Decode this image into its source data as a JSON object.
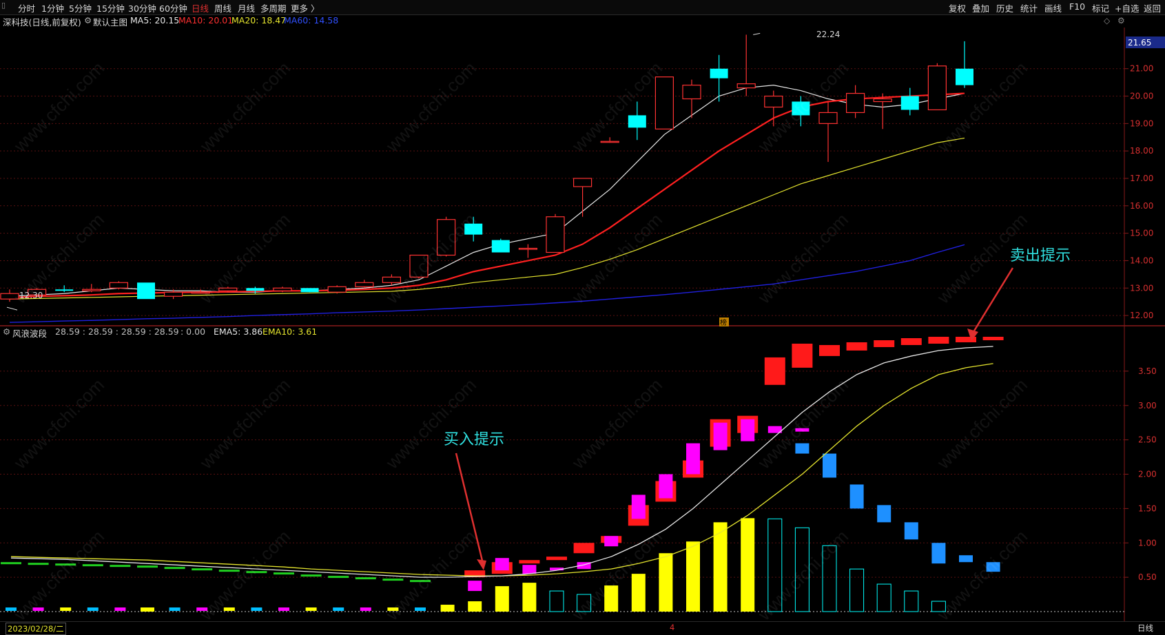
{
  "toolbar": {
    "menu_icon": "menu-icon",
    "periods": [
      "分时",
      "1分钟",
      "5分钟",
      "15分钟",
      "30分钟",
      "60分钟",
      "日线",
      "周线",
      "月线",
      "多周期",
      "更多 〉"
    ],
    "active_period": "日线",
    "right_items": [
      "复权",
      "叠加",
      "历史",
      "统计",
      "画线",
      "F10",
      "标记",
      "+自选",
      "返回"
    ]
  },
  "main_chart": {
    "stock_label": "深科技(日线,前复权)",
    "indicator_name": "默认主图",
    "ma5": "MA5: 20.15",
    "ma10": "MA10: 20.01",
    "ma20": "MA20: 18.47",
    "ma60": "MA60: 14.58",
    "high_label": "22.24",
    "low_label": "12.30",
    "current_price": "21.65",
    "axis_labels": [
      "21.00",
      "20.00",
      "19.00",
      "18.00",
      "17.00",
      "16.00",
      "15.00",
      "14.00",
      "13.00",
      "12.00"
    ],
    "marker_label": "榜"
  },
  "sub_chart": {
    "indicator_name": "风浪波段",
    "values_prefix": "28.59 : 28.59 : 28.59 : 28.59",
    "values_zero": ": 0.00",
    "ema5": "EMA5: 3.86",
    "ema10": "EMA10: 3.61",
    "axis_labels": [
      "3.50",
      "3.00",
      "2.50",
      "2.00",
      "1.50",
      "1.00",
      "0.50"
    ],
    "buy_hint": "买入提示",
    "sell_hint": "卖出提示"
  },
  "status": {
    "date": "2023/02/28/二",
    "month_marker": "4",
    "period": "日线"
  },
  "watermark": "www.cfchi.com",
  "colors": {
    "up": "#ff3232",
    "down": "#00ffff",
    "ma5": "#e8e8e8",
    "ma10": "#ff2020",
    "ma20": "#e6e62e",
    "ma60": "#2020e0",
    "yellow_bar": "#ffff00",
    "magenta": "#ff00ff",
    "blue_block": "#1e90ff",
    "annotation": "#30e0e0"
  },
  "chart_data": [
    {
      "type": "candlestick",
      "title": "深科技(日线,前复权)",
      "x": [
        1,
        2,
        3,
        4,
        5,
        6,
        7,
        8,
        9,
        10,
        11,
        12,
        13,
        14,
        15,
        16,
        17,
        18,
        19,
        20,
        21,
        22,
        23,
        24,
        25,
        26,
        27,
        28,
        29,
        30,
        31,
        32,
        33,
        34,
        35,
        36,
        37
      ],
      "ohlc": [
        [
          12.6,
          12.95,
          12.5,
          12.8
        ],
        [
          12.75,
          13.0,
          12.7,
          12.95
        ],
        [
          12.95,
          13.1,
          12.85,
          12.9
        ],
        [
          12.9,
          13.15,
          12.85,
          12.95
        ],
        [
          13.0,
          13.25,
          12.95,
          13.2
        ],
        [
          13.2,
          13.0,
          12.9,
          12.6
        ],
        [
          12.7,
          12.95,
          12.6,
          12.85
        ],
        [
          12.85,
          12.95,
          12.8,
          12.85
        ],
        [
          12.9,
          13.05,
          12.85,
          13.0
        ],
        [
          13.0,
          13.05,
          12.8,
          12.9
        ],
        [
          12.9,
          13.05,
          12.85,
          13.0
        ],
        [
          13.0,
          12.95,
          12.85,
          12.85
        ],
        [
          12.85,
          13.1,
          12.8,
          13.05
        ],
        [
          13.05,
          13.3,
          13.0,
          13.2
        ],
        [
          13.2,
          13.5,
          13.1,
          13.4
        ],
        [
          13.4,
          14.2,
          13.35,
          14.2
        ],
        [
          14.2,
          15.6,
          14.15,
          15.5
        ],
        [
          15.35,
          15.6,
          14.7,
          14.95
        ],
        [
          14.75,
          14.8,
          14.3,
          14.3
        ],
        [
          14.45,
          14.6,
          14.1,
          14.45
        ],
        [
          14.3,
          15.7,
          14.3,
          15.6
        ],
        [
          16.7,
          17.0,
          15.6,
          17.0
        ],
        [
          18.35,
          18.5,
          18.3,
          18.35
        ],
        [
          19.3,
          19.8,
          18.4,
          18.85
        ],
        [
          18.8,
          20.7,
          18.8,
          20.7
        ],
        [
          19.9,
          20.6,
          19.2,
          20.4
        ],
        [
          21.0,
          21.5,
          19.8,
          20.65
        ],
        [
          20.3,
          22.24,
          20.0,
          20.45
        ],
        [
          19.6,
          20.2,
          18.9,
          20.0
        ],
        [
          19.8,
          20.0,
          18.9,
          19.3
        ],
        [
          19.0,
          19.8,
          17.6,
          19.4
        ],
        [
          19.4,
          20.4,
          19.2,
          20.1
        ],
        [
          19.8,
          20.1,
          18.8,
          19.9
        ],
        [
          20.0,
          20.3,
          19.3,
          19.5
        ],
        [
          19.5,
          21.2,
          19.5,
          21.1
        ],
        [
          21.0,
          22.0,
          20.3,
          20.4
        ]
      ],
      "ylim": [
        11.6,
        22.5
      ],
      "series": [
        {
          "name": "MA5",
          "values": [
            12.7,
            12.75,
            12.8,
            12.9,
            13.0,
            12.95,
            12.9,
            12.9,
            12.85,
            12.85,
            12.9,
            12.9,
            12.95,
            13.0,
            13.1,
            13.3,
            13.8,
            14.3,
            14.6,
            14.8,
            15.0,
            15.8,
            16.6,
            17.6,
            18.6,
            19.3,
            20.0,
            20.3,
            20.4,
            20.2,
            19.9,
            19.7,
            19.6,
            19.7,
            19.9,
            20.1
          ]
        },
        {
          "name": "MA10",
          "values": [
            12.65,
            12.7,
            12.72,
            12.75,
            12.8,
            12.82,
            12.84,
            12.85,
            12.86,
            12.88,
            12.9,
            12.9,
            12.92,
            12.95,
            13.0,
            13.1,
            13.3,
            13.6,
            13.8,
            14.0,
            14.2,
            14.6,
            15.2,
            15.9,
            16.6,
            17.3,
            18.0,
            18.6,
            19.2,
            19.6,
            19.8,
            19.9,
            19.95,
            20.0,
            20.05,
            20.1
          ]
        },
        {
          "name": "MA20",
          "values": [
            12.6,
            12.62,
            12.64,
            12.66,
            12.68,
            12.7,
            12.72,
            12.74,
            12.76,
            12.78,
            12.8,
            12.82,
            12.84,
            12.86,
            12.88,
            12.95,
            13.05,
            13.2,
            13.3,
            13.4,
            13.5,
            13.75,
            14.05,
            14.4,
            14.8,
            15.2,
            15.6,
            16.0,
            16.4,
            16.8,
            17.1,
            17.4,
            17.7,
            18.0,
            18.3,
            18.47
          ]
        },
        {
          "name": "MA60",
          "values": [
            11.75,
            11.77,
            11.8,
            11.82,
            11.85,
            11.88,
            11.9,
            11.93,
            11.96,
            12.0,
            12.03,
            12.06,
            12.1,
            12.13,
            12.16,
            12.2,
            12.25,
            12.3,
            12.35,
            12.4,
            12.46,
            12.52,
            12.6,
            12.68,
            12.76,
            12.85,
            12.95,
            13.05,
            13.15,
            13.3,
            13.45,
            13.6,
            13.8,
            14.0,
            14.3,
            14.58
          ]
        }
      ]
    },
    {
      "type": "bar",
      "title": "风浪波段",
      "ylim": [
        0,
        3.95
      ],
      "yellow_values": [
        0.02,
        0.01,
        0.02,
        0.02,
        0.03,
        0.06,
        0.01,
        0.01,
        0.0,
        0.0,
        0.0,
        0.0,
        0.0,
        0.0,
        0.0,
        0.0,
        0.1,
        0.15,
        0.37,
        0.42,
        0.31,
        0.25,
        0.38,
        0.55,
        0.85,
        1.02,
        1.3,
        1.36,
        1.35,
        1.22,
        0.96,
        0.62,
        0.4,
        0.3,
        0.15,
        0.0,
        0.02,
        0.0
      ],
      "cyan_outline_values": [
        0,
        0,
        0,
        0,
        0,
        0,
        0,
        0,
        0,
        0,
        0,
        0,
        0,
        0,
        0,
        0,
        0,
        0,
        0,
        0,
        0.3,
        0.25,
        0,
        0,
        0,
        0,
        0,
        0,
        1.35,
        1.22,
        0.96,
        0.62,
        0.4,
        0.3,
        0.15,
        0,
        0,
        0
      ],
      "red_blocks": [
        [
          0,
          0,
          0
        ],
        [
          0,
          0,
          0
        ],
        [
          0,
          0,
          0
        ],
        [
          0,
          0,
          0
        ],
        [
          0,
          0,
          0
        ],
        [
          0,
          0,
          0
        ],
        [
          0,
          0,
          0
        ],
        [
          0,
          0,
          0
        ],
        [
          0,
          0,
          0
        ],
        [
          0,
          0,
          0
        ],
        [
          0,
          0,
          0
        ],
        [
          0,
          0,
          0
        ],
        [
          0,
          0,
          0
        ],
        [
          0,
          0,
          0
        ],
        [
          0,
          0,
          0
        ],
        [
          0,
          0,
          0
        ],
        [
          0,
          0,
          0
        ],
        [
          0.5,
          0.6,
          1
        ],
        [
          0.55,
          0.72,
          1
        ],
        [
          0.7,
          0.75,
          1
        ],
        [
          0.75,
          0.8,
          1
        ],
        [
          0.85,
          1.0,
          1
        ],
        [
          1.0,
          1.1,
          1
        ],
        [
          1.25,
          1.55,
          1
        ],
        [
          1.6,
          1.9,
          1
        ],
        [
          1.95,
          2.2,
          1
        ],
        [
          2.4,
          2.8,
          1
        ],
        [
          2.6,
          2.85,
          1
        ],
        [
          3.3,
          3.7,
          1
        ],
        [
          3.55,
          3.9,
          1
        ],
        [
          3.72,
          3.88,
          1
        ],
        [
          3.8,
          3.92,
          1
        ],
        [
          3.85,
          3.95,
          1
        ],
        [
          3.88,
          3.98,
          1
        ],
        [
          3.9,
          4.0,
          1
        ],
        [
          3.92,
          4.0,
          1
        ],
        [
          3.95,
          4.0,
          1
        ]
      ],
      "ema5_values": [
        0.78,
        0.77,
        0.76,
        0.74,
        0.72,
        0.7,
        0.68,
        0.66,
        0.64,
        0.62,
        0.6,
        0.58,
        0.56,
        0.54,
        0.52,
        0.5,
        0.5,
        0.51,
        0.52,
        0.55,
        0.6,
        0.68,
        0.8,
        0.98,
        1.2,
        1.5,
        1.85,
        2.2,
        2.55,
        2.9,
        3.2,
        3.45,
        3.62,
        3.72,
        3.8,
        3.84,
        3.86
      ],
      "ema10_values": [
        0.8,
        0.79,
        0.78,
        0.77,
        0.76,
        0.75,
        0.73,
        0.71,
        0.69,
        0.67,
        0.65,
        0.62,
        0.6,
        0.58,
        0.56,
        0.54,
        0.53,
        0.52,
        0.52,
        0.53,
        0.55,
        0.58,
        0.62,
        0.7,
        0.8,
        0.95,
        1.15,
        1.4,
        1.7,
        2.0,
        2.35,
        2.7,
        3.0,
        3.25,
        3.45,
        3.55,
        3.61
      ]
    }
  ]
}
